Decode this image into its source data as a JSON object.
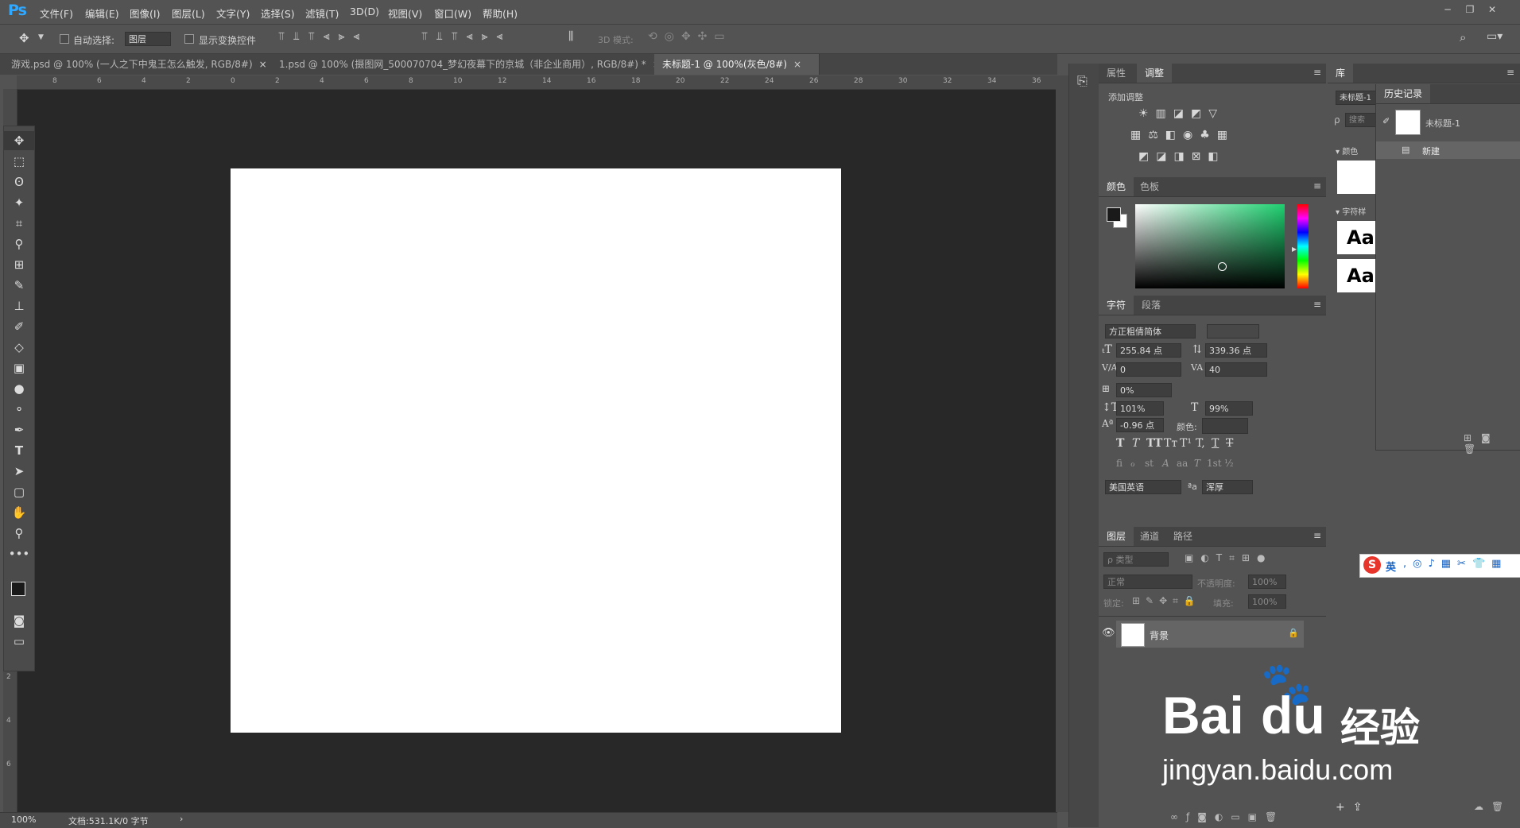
{
  "app": {
    "logo": "Ps"
  },
  "menu": [
    "文件(F)",
    "编辑(E)",
    "图像(I)",
    "图层(L)",
    "文字(Y)",
    "选择(S)",
    "滤镜(T)",
    "3D(D)",
    "视图(V)",
    "窗口(W)",
    "帮助(H)"
  ],
  "window_controls": {
    "minimize": "─",
    "restore": "❐",
    "close": "✕"
  },
  "options": {
    "auto_select_label": "自动选择:",
    "auto_select_value": "图层",
    "show_transform_label": "显示变换控件",
    "mode_3d_label": "3D 模式:"
  },
  "tabs": [
    {
      "label": "游戏.psd @ 100% (一人之下中鬼王怎么触发, RGB/8#)",
      "close": "×"
    },
    {
      "label": "1.psd @ 100% (摄图网_500070704_梦幻夜幕下的京城（非企业商用）, RGB/8#) *",
      "close": "×"
    },
    {
      "label": "未标题-1 @ 100%(灰色/8#)",
      "close": "×"
    }
  ],
  "ruler": {
    "h_ticks": [
      "8",
      "6",
      "4",
      "2",
      "0",
      "2",
      "4",
      "6",
      "8",
      "10",
      "12",
      "14",
      "16",
      "18",
      "20",
      "22",
      "24",
      "26",
      "28",
      "30",
      "32",
      "34",
      "36"
    ],
    "v_ticks": [
      "2",
      "4",
      "6"
    ]
  },
  "status": {
    "zoom": "100%",
    "doc": "文档:531.1K/0 字节",
    "arrow": "›"
  },
  "adjust_panel": {
    "tab_properties": "属性",
    "tab_adjustments": "调整",
    "add_label": "添加调整",
    "menu": "≡"
  },
  "color_panel": {
    "tab_color": "颜色",
    "tab_swatches": "色板",
    "menu": "≡"
  },
  "char_panel": {
    "tab_char": "字符",
    "tab_para": "段落",
    "menu": "≡",
    "font": "方正粗倩简体",
    "size": "255.84 点",
    "leading": "339.36 点",
    "kerning": "0",
    "tracking": "40",
    "scale_tsume": "0%",
    "vscale": "101%",
    "hscale": "99%",
    "baseline": "-0.96 点",
    "color_label": "颜色:",
    "style_glyphs": [
      "T",
      "T",
      "TT",
      "Tт",
      "T¹",
      "T,",
      "T",
      "T"
    ],
    "ot_glyphs": [
      "fi",
      "ℴ",
      "st",
      "A",
      "aa",
      "T",
      "1st",
      "½"
    ],
    "language": "美国英语",
    "aa_label": "ªa",
    "aa_value": "浑厚"
  },
  "layers_panel": {
    "tab_layers": "图层",
    "tab_channels": "通道",
    "tab_paths": "路径",
    "menu": "≡",
    "filter_kind": "ρ 类型",
    "blend": "正常",
    "opacity_label": "不透明度:",
    "opacity": "100%",
    "lock_label": "锁定:",
    "fill_label": "填充:",
    "fill": "100%",
    "layer_name": "背景"
  },
  "library_panel": {
    "tab": "库",
    "doc_select": "未标题-1",
    "search_placeholder": "搜索",
    "color_section": "颜色",
    "char_section": "字符样",
    "aa1": "Aa",
    "aa2": "Aa"
  },
  "history_panel": {
    "tab": "历史记录",
    "snapshot": "未标题-1",
    "step": "新建",
    "menu": "≡"
  },
  "ime": {
    "logo": "S",
    "lang": "英"
  },
  "watermark": {
    "brand": "Bai",
    "paw": "🐾",
    "du": "du",
    "cn": "经验",
    "url": "jingyan.baidu.com"
  }
}
